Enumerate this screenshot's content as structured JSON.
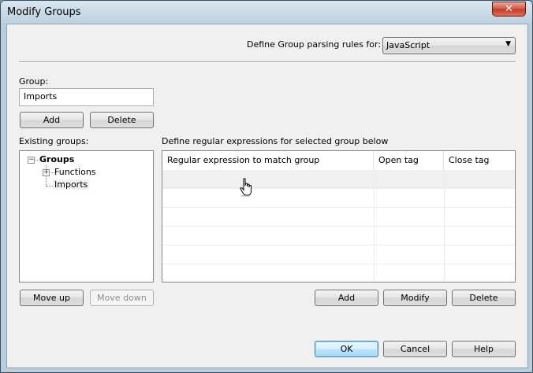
{
  "window": {
    "title": "Modify Groups",
    "close_glyph": "✕"
  },
  "parsing": {
    "label": "Define Group parsing rules for:",
    "selected_language": "JavaScript"
  },
  "group": {
    "label": "Group:",
    "value": "Imports",
    "add_label": "Add",
    "delete_label": "Delete"
  },
  "existing": {
    "label": "Existing groups:",
    "tree": {
      "root": "Groups",
      "children": [
        "Functions",
        "Imports"
      ]
    },
    "move_up_label": "Move up",
    "move_down_label": "Move down"
  },
  "regex": {
    "label": "Define regular expressions for selected group below",
    "columns": [
      "Regular expression to match group",
      "Open tag",
      "Close tag"
    ],
    "add_label": "Add",
    "modify_label": "Modify",
    "delete_label": "Delete"
  },
  "footer": {
    "ok_label": "OK",
    "cancel_label": "Cancel",
    "help_label": "Help"
  },
  "icons": {
    "collapse": "minus-box-icon",
    "expand": "plus-box-icon",
    "dropdown": "chevron-down-icon",
    "cursor": "hand-pointer-icon"
  }
}
